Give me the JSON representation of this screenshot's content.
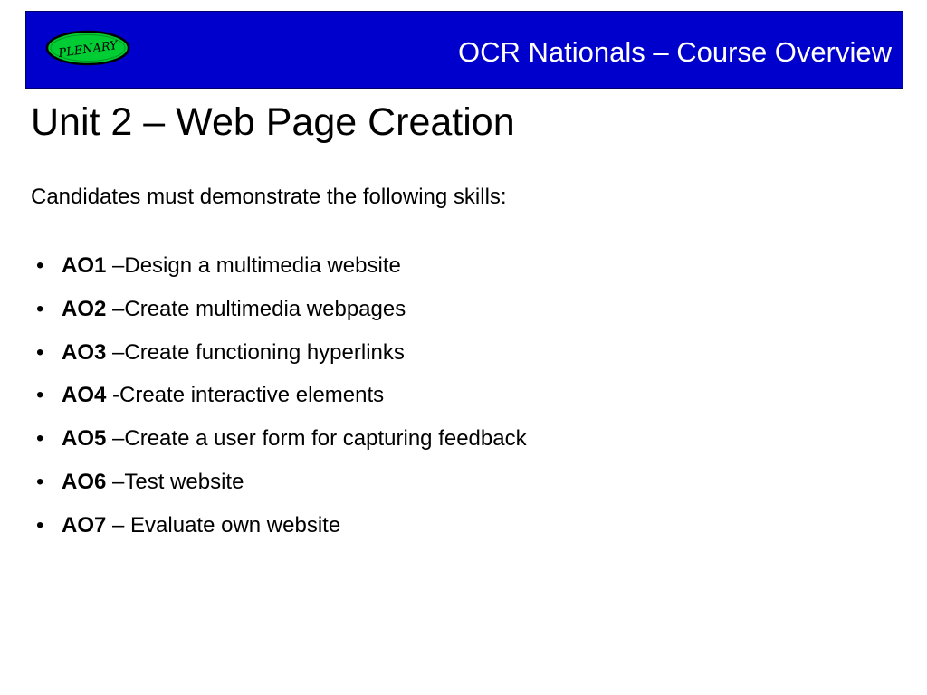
{
  "header": {
    "title": "OCR Nationals – Course Overview",
    "logo_text": "PLENARY",
    "background_color": "#0000cc",
    "title_color": "#ffffff"
  },
  "logo": {
    "fill_color": "#00cc33",
    "outline_color": "#000000",
    "text_color": "#000000"
  },
  "slide": {
    "title": "Unit 2 – Web Page Creation",
    "intro": "Candidates must demonstrate the following skills:",
    "bullet_glyph": "•",
    "objectives": [
      {
        "code": "AO1",
        "text": " –Design a multimedia website"
      },
      {
        "code": "AO2",
        "text": " –Create multimedia webpages"
      },
      {
        "code": "AO3",
        "text": " –Create functioning hyperlinks"
      },
      {
        "code": "AO4",
        "text": " -Create interactive elements"
      },
      {
        "code": "AO5",
        "text": " –Create a user form for capturing feedback"
      },
      {
        "code": "AO6",
        "text": " –Test website"
      },
      {
        "code": "AO7",
        "text": " – Evaluate own website"
      }
    ]
  }
}
